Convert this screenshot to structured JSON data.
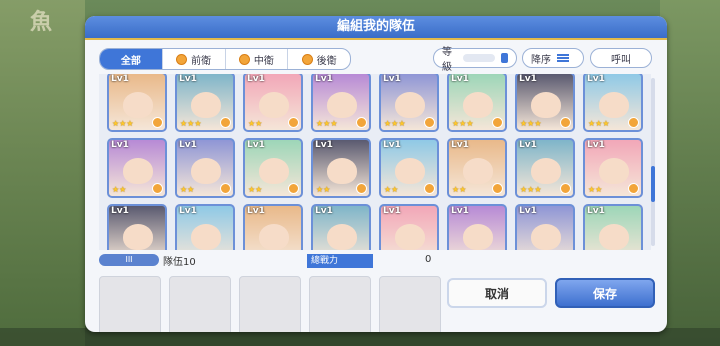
{
  "dialog": {
    "title": "編組我的隊伍"
  },
  "background": {
    "logo_text": "魚"
  },
  "filters": [
    {
      "label": "全部",
      "active": true
    },
    {
      "label": "前衛",
      "active": false
    },
    {
      "label": "中衛",
      "active": false
    },
    {
      "label": "後衛",
      "active": false
    }
  ],
  "sort": {
    "level_label": "等級",
    "order_label": "降序",
    "call_label": "呼叫"
  },
  "roster": {
    "level_text": "Lv1",
    "rows": [
      {
        "stars": [
          "★★★",
          "★★★",
          "★★",
          "★★★",
          "★★★",
          "★★★",
          "★★★",
          "★★★"
        ]
      },
      {
        "stars": [
          "★★",
          "★★",
          "★★",
          "★★",
          "★★",
          "★★",
          "★★★",
          "★★"
        ]
      },
      {
        "stars": [
          "",
          "",
          "",
          "",
          "",
          "",
          "",
          ""
        ]
      }
    ]
  },
  "team": {
    "label": "III",
    "count_text": "隊伍10"
  },
  "power": {
    "label": "總戰力",
    "value": "0"
  },
  "buttons": {
    "cancel": "取消",
    "save": "保存"
  }
}
